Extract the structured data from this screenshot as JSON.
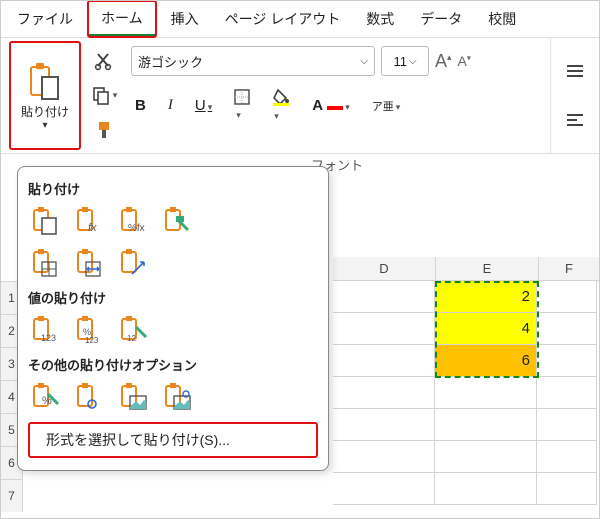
{
  "tabs": {
    "file": "ファイル",
    "home": "ホーム",
    "insert": "挿入",
    "pagelayout": "ページ レイアウト",
    "formulas": "数式",
    "data": "データ",
    "review": "校閲"
  },
  "ribbon": {
    "paste_label": "貼り付け",
    "font_name": "游ゴシック",
    "font_size": "11",
    "bold": "B",
    "italic": "I",
    "underline": "U",
    "ruby": "ア亜",
    "group_font_label": "フォント"
  },
  "dropdown": {
    "sec_paste": "貼り付け",
    "sec_values": "値の貼り付け",
    "sec_other": "その他の貼り付けオプション",
    "paste_special": "形式を選択して貼り付け(S)..."
  },
  "grid": {
    "cols": [
      "D",
      "E",
      "F"
    ],
    "rows": [
      "1",
      "2",
      "3",
      "4",
      "5",
      "6",
      "7"
    ],
    "e1": "2",
    "e2": "4",
    "e3": "6"
  }
}
